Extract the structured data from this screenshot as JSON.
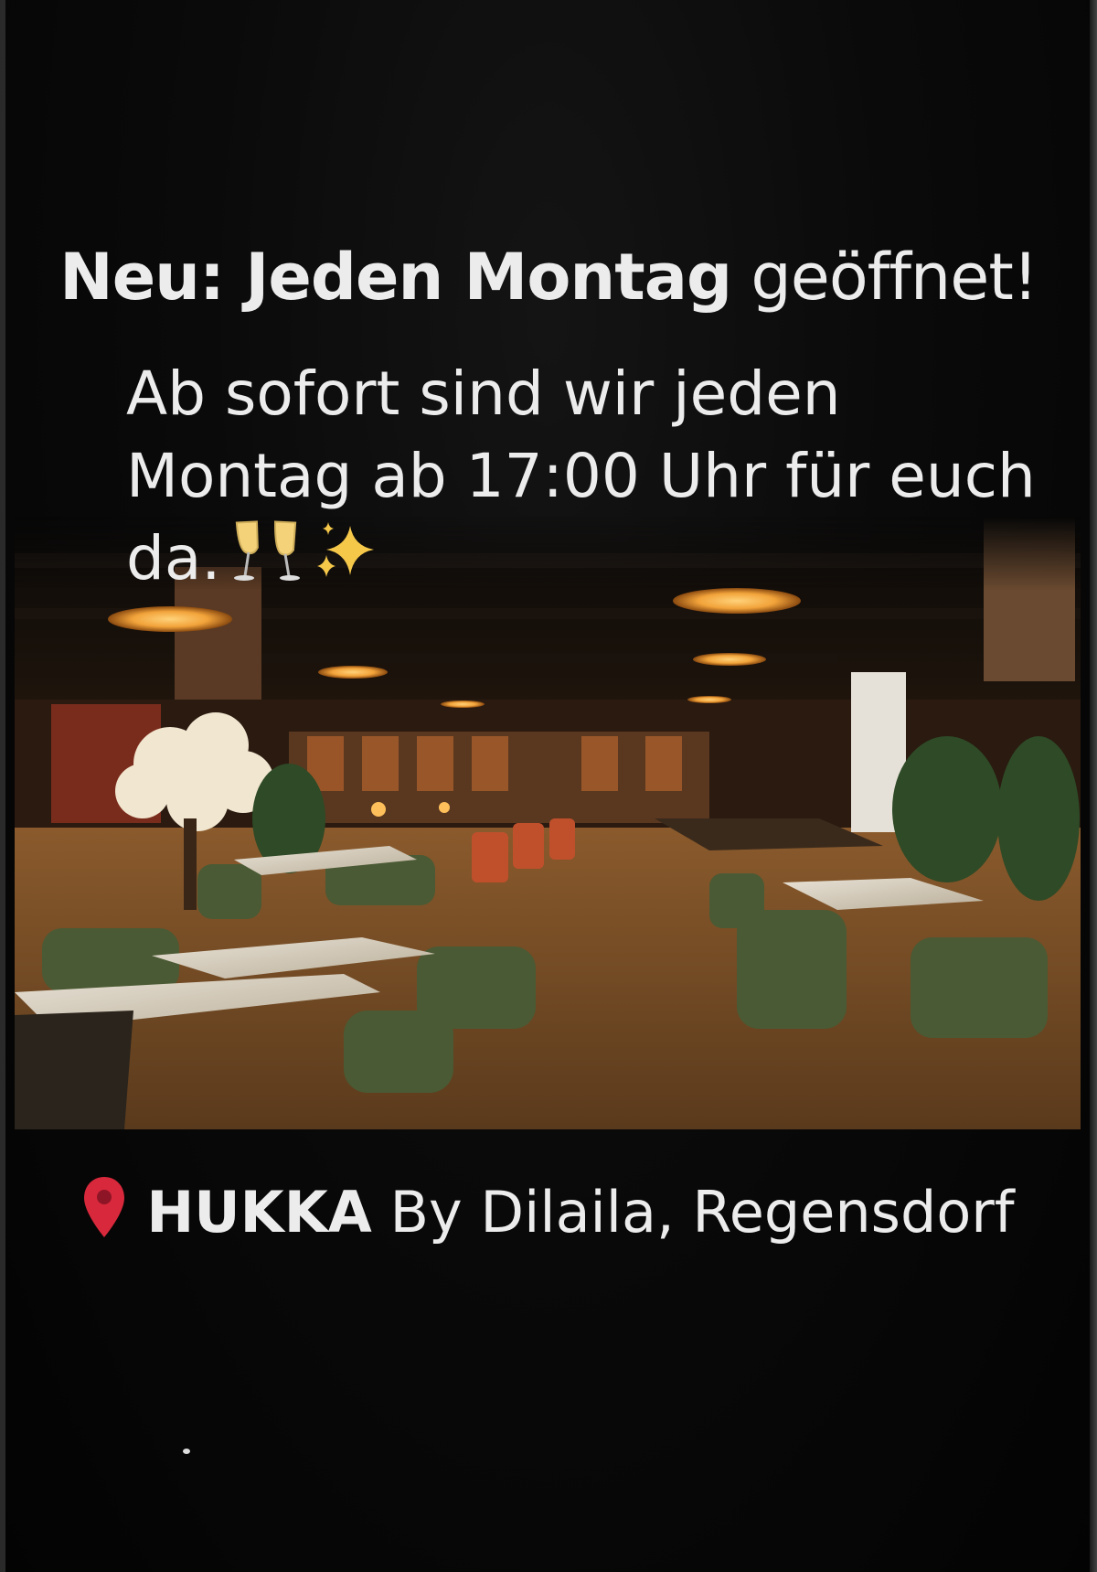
{
  "headline": {
    "bold": "Neu: Jeden Montag",
    "regular": " geöffnet!"
  },
  "subtext": "Ab sofort sind wir jeden Montag ab 17:00 Uhr für euch da.",
  "emojis": [
    "champagne-glasses-icon",
    "sparkles-icon"
  ],
  "photo": {
    "subject": "restaurant interior"
  },
  "location": {
    "icon": "location-pin-icon",
    "name_bold": "HUKKA",
    "name_rest": " By Dilaila, Regensdorf"
  },
  "colors": {
    "background": "#060606",
    "text": "#ececec",
    "pin": "#d8283c",
    "warm_light": "#f2a33a"
  }
}
